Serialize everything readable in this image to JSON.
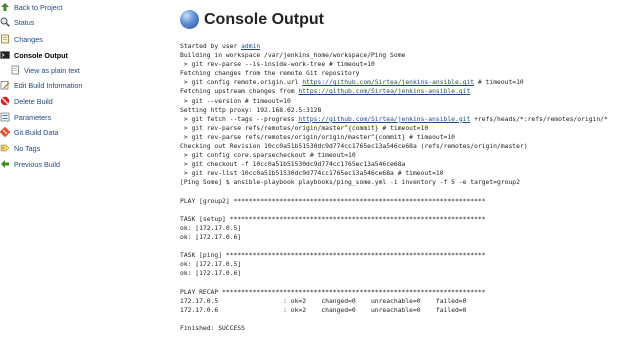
{
  "sidebar": {
    "items": [
      {
        "label": "Back to Project",
        "icon": "up-arrow-icon"
      },
      {
        "label": "Status",
        "icon": "search-icon"
      },
      {
        "label": "Changes",
        "icon": "notepad-icon"
      },
      {
        "label": "Console Output",
        "icon": "terminal-icon"
      },
      {
        "label": "View as plain text",
        "icon": "document-icon"
      },
      {
        "label": "Edit Build Information",
        "icon": "edit-icon"
      },
      {
        "label": "Delete Build",
        "icon": "no-entry-icon"
      },
      {
        "label": "Parameters",
        "icon": "parameters-icon"
      },
      {
        "label": "Git Build Data",
        "icon": "git-icon"
      },
      {
        "label": "No Tags",
        "icon": "tag-icon"
      },
      {
        "label": "Previous Build",
        "icon": "left-arrow-icon"
      }
    ]
  },
  "page": {
    "title": "Console Output"
  },
  "console": {
    "line0_prefix": "Started by user ",
    "line0_user": "admin",
    "line1": "Building in workspace /var/jenkins_home/workspace/Ping Some",
    "line2": " > git rev-parse --is-inside-work-tree # timeout=10",
    "line3": "Fetching changes from the remote Git repository",
    "line4_prefix": " > git config remote.origin.url ",
    "line4_link": "https://github.com/Sirtea/jenkins-ansible.git",
    "line4_suffix": " # timeout=10",
    "line5_prefix": "Fetching upstream changes from ",
    "line5_link": "https://github.com/Sirtea/jenkins-ansible.git",
    "line6": " > git --version # timeout=10",
    "line7": "Setting http proxy: 192.168.62.5:3128",
    "line8_prefix": " > git fetch --tags --progress ",
    "line8_link": "https://github.com/Sirtea/jenkins-ansible.git",
    "line8_suffix": " +refs/heads/*:refs/remotes/origin/*",
    "line9": " > git rev-parse refs/remotes/origin/master^{commit} # timeout=10",
    "line10": " > git rev-parse refs/remotes/origin/origin/master^{commit} # timeout=10",
    "line11": "Checking out Revision 10cc0a51b51530dc9d774cc1765ec13a546ce68a (refs/remotes/origin/master)",
    "line12": " > git config core.sparsecheckout # timeout=10",
    "line13": " > git checkout -f 10cc0a51b51530dc9d774cc1765ec13a546ce68a",
    "line14": " > git rev-list 10cc0a51b51530dc9d774cc1765ec13a546ce68a # timeout=10",
    "line15": "[Ping Some] $ ansible-playbook playbooks/ping_some.yml -i inventory -f 5 -e target=group2",
    "line16": "",
    "line17": "PLAY [group2] ******************************************************************",
    "line18": "",
    "line19": "TASK [setup] *******************************************************************",
    "line20": "ok: [172.17.0.5]",
    "line21": "ok: [172.17.0.6]",
    "line22": "",
    "line23": "TASK [ping] ********************************************************************",
    "line24": "ok: [172.17.0.5]",
    "line25": "ok: [172.17.0.6]",
    "line26": "",
    "line27": "PLAY RECAP *********************************************************************",
    "line28": "172.17.0.5                 : ok=2    changed=0    unreachable=0    failed=0",
    "line29": "172.17.0.6                 : ok=2    changed=0    unreachable=0    failed=0",
    "line30": "",
    "line31": "Finished: SUCCESS"
  }
}
